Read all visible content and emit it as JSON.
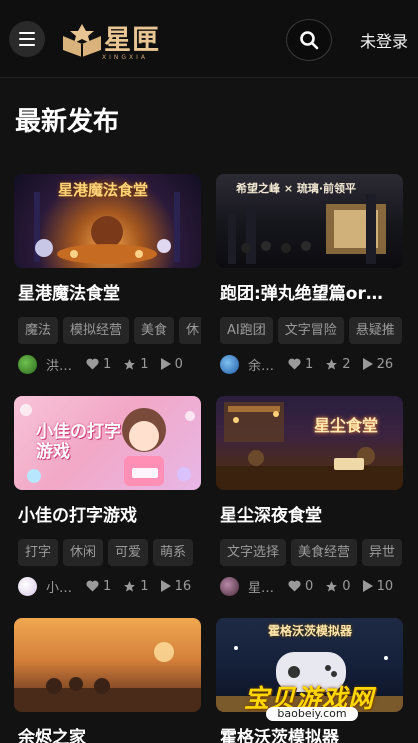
{
  "header": {
    "logo_text": "星匣",
    "logo_sub": "XINGXIA",
    "login_label": "未登录"
  },
  "section": {
    "title": "最新发布"
  },
  "cards": [
    {
      "thumb_text": "星港魔法食堂",
      "title": "星港魔法食堂",
      "tags": [
        "魔法",
        "模拟经营",
        "美食",
        "休"
      ],
      "author": "洪…",
      "likes": "1",
      "stars": "1",
      "plays": "0"
    },
    {
      "thumb_text": "希望之峰 × 琉璃·前领平",
      "title": "跑团:弹丸绝望篇or…",
      "tags": [
        "AI跑团",
        "文字冒险",
        "悬疑推"
      ],
      "author": "余…",
      "likes": "1",
      "stars": "2",
      "plays": "26"
    },
    {
      "thumb_text": "小佳の打字游戏",
      "title": "小佳の打字游戏",
      "tags": [
        "打字",
        "休闲",
        "可爱",
        "萌系"
      ],
      "author": "小…",
      "likes": "1",
      "stars": "1",
      "plays": "16"
    },
    {
      "thumb_text": "星尘食堂",
      "title": "星尘深夜食堂",
      "tags": [
        "文字选择",
        "美食经营",
        "异世"
      ],
      "author": "星…",
      "likes": "0",
      "stars": "0",
      "plays": "10"
    },
    {
      "thumb_text": "",
      "title": "余烬之家",
      "tags": [],
      "author": "",
      "likes": "",
      "stars": "",
      "plays": ""
    },
    {
      "thumb_text": "霍格沃茨模拟器",
      "title": "霍格沃茨模拟器",
      "tags": [],
      "author": "",
      "likes": "",
      "stars": "",
      "plays": ""
    }
  ],
  "watermark": {
    "text": "宝贝游戏网",
    "url": "baobeiy.com"
  }
}
